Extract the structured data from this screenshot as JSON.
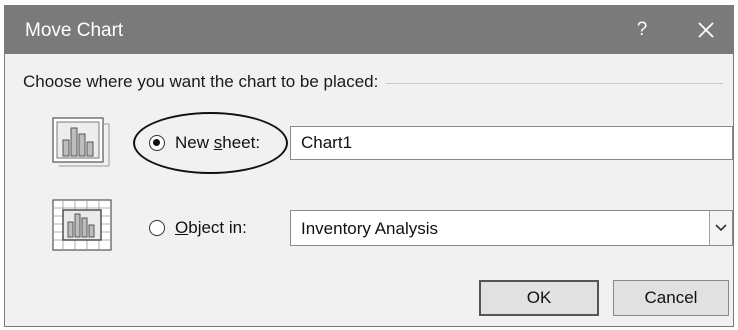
{
  "dialog": {
    "title": "Move Chart",
    "help_label": "?",
    "group_label": "Choose where you want the chart to be placed:",
    "options": [
      {
        "label_prefix": "New ",
        "label_accel": "s",
        "label_suffix": "heet:",
        "selected": true,
        "icon": "chart-sheet-icon",
        "value": "Chart1"
      },
      {
        "label_prefix": "",
        "label_accel": "O",
        "label_suffix": "bject in:",
        "selected": false,
        "icon": "embedded-chart-icon",
        "value": "Inventory Analysis"
      }
    ],
    "ok_label": "OK",
    "cancel_label": "Cancel"
  }
}
